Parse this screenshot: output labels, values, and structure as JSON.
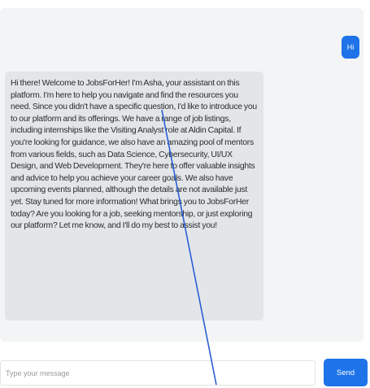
{
  "chat": {
    "user_message": "Hi",
    "bot_message": "Hi there! Welcome to JobsForHer! I'm Asha, your assistant on this platform. I'm here to help you navigate and find the resources you need. Since you didn't have a specific question, I'd like to introduce you to our platform and its offerings. We have a range of job listings, including internships like the Visiting Analyst role at Aldin Capital. If you're looking for guidance, we also have an amazing pool of mentors from various fields, such as Data Science, Cybersecurity, UI/UX Design, and Web Development. They're here to offer valuable insights and advice to help you achieve your career goals. We also have upcoming events planned, although the details are not available just yet. Stay tuned for more information! What brings you to JobsForHer today? Are you looking for a job, seeking mentorship, or just exploring our platform? Let me know, and I'll do my best to assist you!"
  },
  "composer": {
    "placeholder": "Type your message",
    "send_label": "Send"
  },
  "colors": {
    "accent": "#1e73e8",
    "bot_bubble": "#e3e6e9",
    "panel": "#f2f4f5",
    "annotation_line": "#2a5fd6"
  }
}
